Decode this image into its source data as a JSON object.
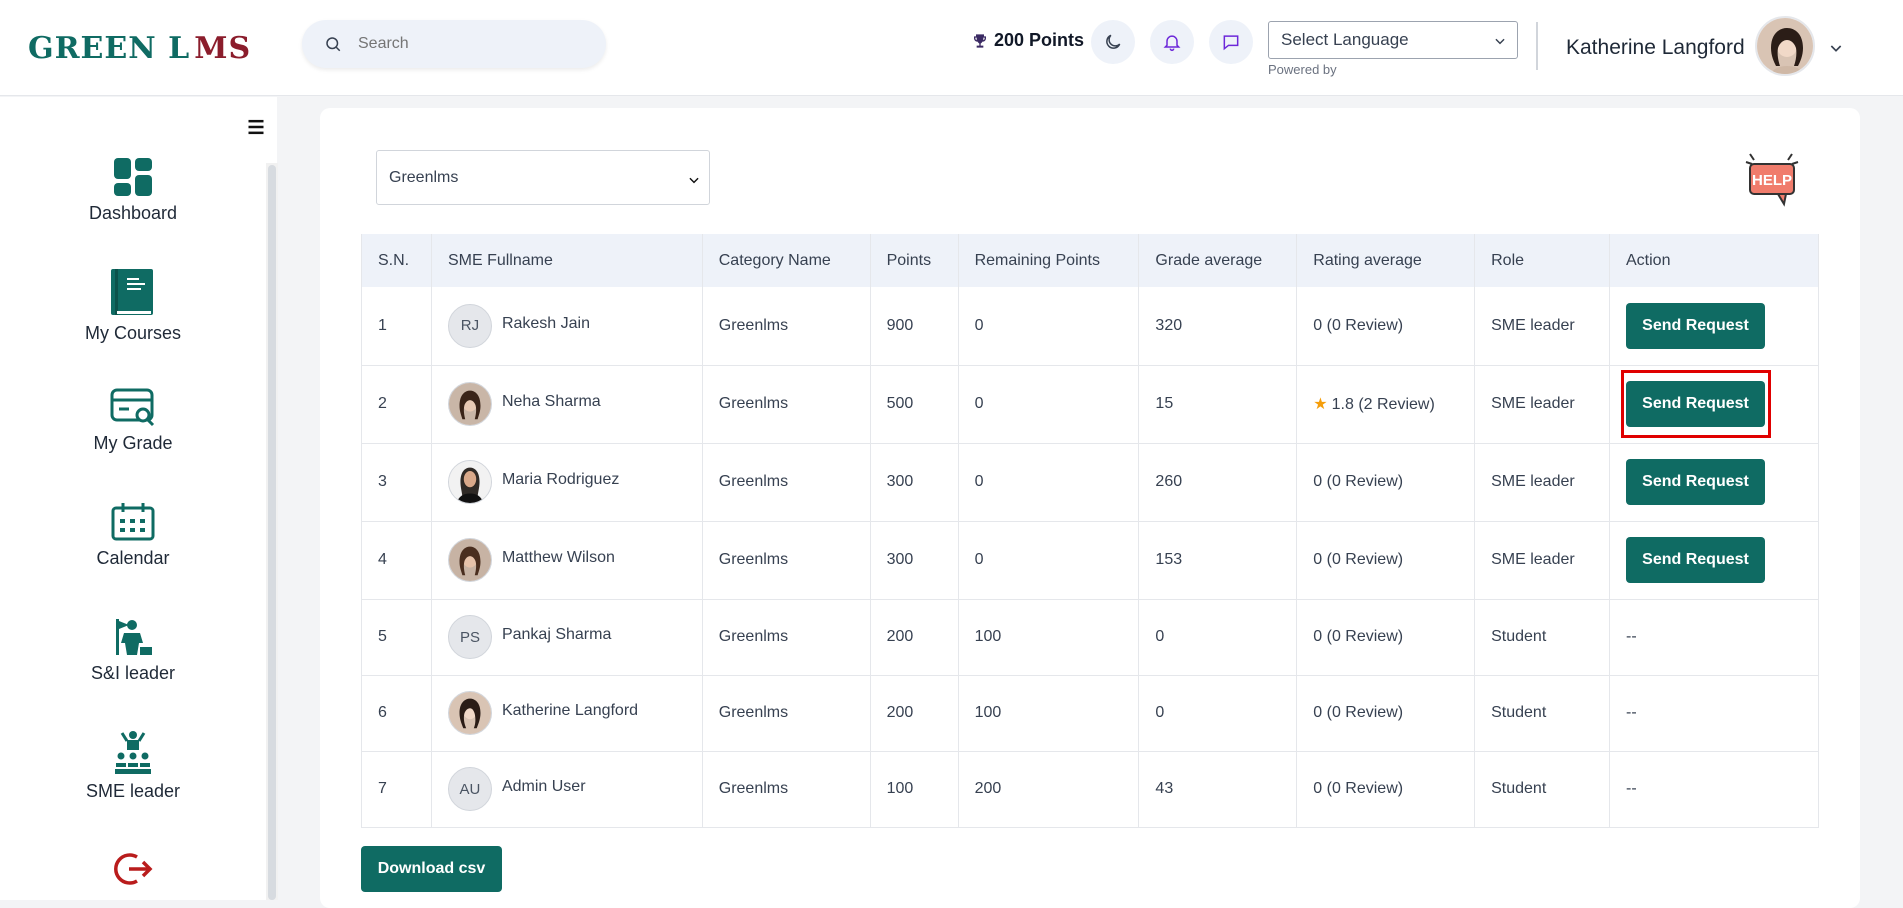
{
  "header": {
    "logo_text_a": "GREEN L",
    "logo_text_b": "MS",
    "search_placeholder": "Search",
    "points": "200 Points",
    "language_label": "Select Language",
    "powered_by": "Powered by",
    "user_name": "Katherine Langford"
  },
  "sidebar": {
    "items": [
      {
        "label": "Dashboard",
        "icon": "dashboard-icon"
      },
      {
        "label": "My Courses",
        "icon": "book-icon"
      },
      {
        "label": "My Grade",
        "icon": "grade-card-icon"
      },
      {
        "label": "Calendar",
        "icon": "calendar-icon"
      },
      {
        "label": "S&I leader",
        "icon": "leader-icon"
      },
      {
        "label": "SME leader",
        "icon": "team-leader-icon"
      },
      {
        "label": "",
        "icon": "logout-icon"
      }
    ]
  },
  "filter": {
    "selected": "Greenlms"
  },
  "help_label": "HELP",
  "table": {
    "headers": [
      "S.N.",
      "SME Fullname",
      "Category Name",
      "Points",
      "Remaining Points",
      "Grade average",
      "Rating average",
      "Role",
      "Action"
    ],
    "rows": [
      {
        "sn": "1",
        "name": "Rakesh Jain",
        "initials": "RJ",
        "category": "Greenlms",
        "points": "900",
        "remaining": "0",
        "grade": "320",
        "rating": "0 (0 Review)",
        "star": false,
        "role": "SME leader",
        "action": "Send Request"
      },
      {
        "sn": "2",
        "name": "Neha Sharma",
        "initials": "",
        "category": "Greenlms",
        "points": "500",
        "remaining": "0",
        "grade": "15",
        "rating": "1.8 (2 Review)",
        "star": true,
        "role": "SME leader",
        "action": "Send Request"
      },
      {
        "sn": "3",
        "name": "Maria Rodriguez",
        "initials": "",
        "category": "Greenlms",
        "points": "300",
        "remaining": "0",
        "grade": "260",
        "rating": "0 (0 Review)",
        "star": false,
        "role": "SME leader",
        "action": "Send Request"
      },
      {
        "sn": "4",
        "name": "Matthew Wilson",
        "initials": "",
        "category": "Greenlms",
        "points": "300",
        "remaining": "0",
        "grade": "153",
        "rating": "0 (0 Review)",
        "star": false,
        "role": "SME leader",
        "action": "Send Request"
      },
      {
        "sn": "5",
        "name": "Pankaj Sharma",
        "initials": "PS",
        "category": "Greenlms",
        "points": "200",
        "remaining": "100",
        "grade": "0",
        "rating": "0 (0 Review)",
        "star": false,
        "role": "Student",
        "action": "--"
      },
      {
        "sn": "6",
        "name": "Katherine Langford",
        "initials": "",
        "category": "Greenlms",
        "points": "200",
        "remaining": "100",
        "grade": "0",
        "rating": "0 (0 Review)",
        "star": false,
        "role": "Student",
        "action": "--"
      },
      {
        "sn": "7",
        "name": "Admin User",
        "initials": "AU",
        "category": "Greenlms",
        "points": "100",
        "remaining": "200",
        "grade": "43",
        "rating": "0 (0 Review)",
        "star": false,
        "role": "Student",
        "action": "--"
      }
    ]
  },
  "download_label": "Download csv",
  "colors": {
    "primary": "#0f6b63",
    "brand_red": "#8b1d2c",
    "highlight": "#e00000"
  }
}
